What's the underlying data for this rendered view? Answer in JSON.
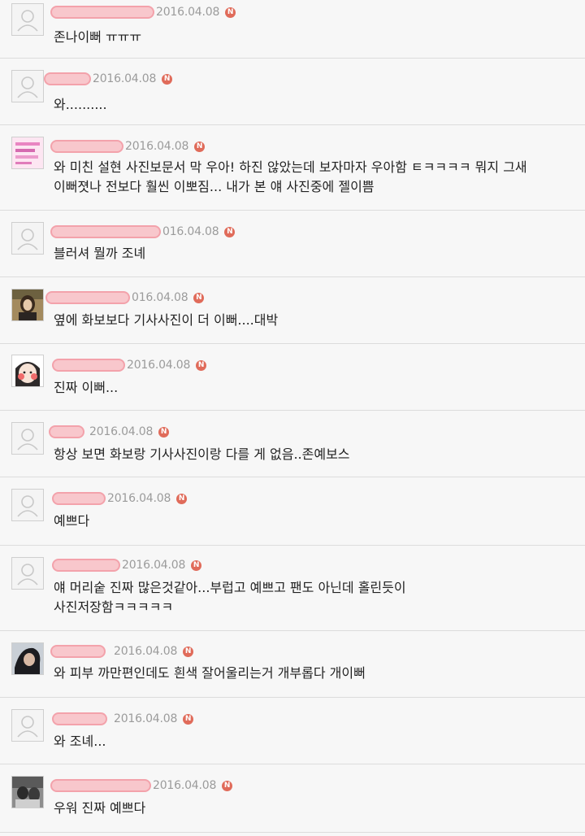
{
  "badge_letter": "N",
  "colors": {
    "badge": "#e06b5a",
    "redaction_fill": "#f8c7cc",
    "date": "#9b9b9b",
    "text": "#222222"
  },
  "comments": [
    {
      "date": "2016.04.08",
      "avatar": "default-avatar",
      "text": "존나이뻐 ㅠㅠㅠ"
    },
    {
      "date": "2016.04.08",
      "avatar": "default-avatar",
      "text": "와.........."
    },
    {
      "date": "2016.04.08",
      "avatar": "pink-sticker-avatar",
      "text": "와 미친 설현 사진보문서 막 우아! 하진 않았는데 보자마자 우아함 ㅌㅋㅋㅋㅋ 뭐지 그새\n이뻐졋나 전보다 훨씬 이뽀짐... 내가 본 얘 사진중에 젤이쁨"
    },
    {
      "date": "016.04.08",
      "avatar": "default-avatar",
      "text": "블러셔 뭘까 조녜"
    },
    {
      "date": "016.04.08",
      "avatar": "photo-avatar-woman",
      "text": "옆에 화보보다 기사사진이 더 이뻐....대박"
    },
    {
      "date": "2016.04.08",
      "avatar": "photo-avatar-cartoon",
      "text": "진짜 이뻐..."
    },
    {
      "date": "2016.04.08",
      "avatar": "default-avatar",
      "text": "항상 보면 화보랑 기사사진이랑 다를 게 없음..존예보스"
    },
    {
      "date": "2016.04.08",
      "avatar": "default-avatar",
      "text": "예쁘다"
    },
    {
      "date": "2016.04.08",
      "avatar": "default-avatar",
      "text": "얘 머리숱 진짜 많은것같아...부럽고 예쁘고 팬도 아닌데 홀린듯이\n사진저장함ㅋㅋㅋㅋㅋ"
    },
    {
      "date": "2016.04.08",
      "avatar": "photo-avatar-dark",
      "text": "와 피부 까만편인데도 흰색 잘어울리는거 개부롭다 개이뻐"
    },
    {
      "date": "2016.04.08",
      "avatar": "default-avatar",
      "text": "와 조녜..."
    },
    {
      "date": "2016.04.08",
      "avatar": "photo-avatar-bw",
      "text": "우워 진짜 예쁘다"
    }
  ]
}
